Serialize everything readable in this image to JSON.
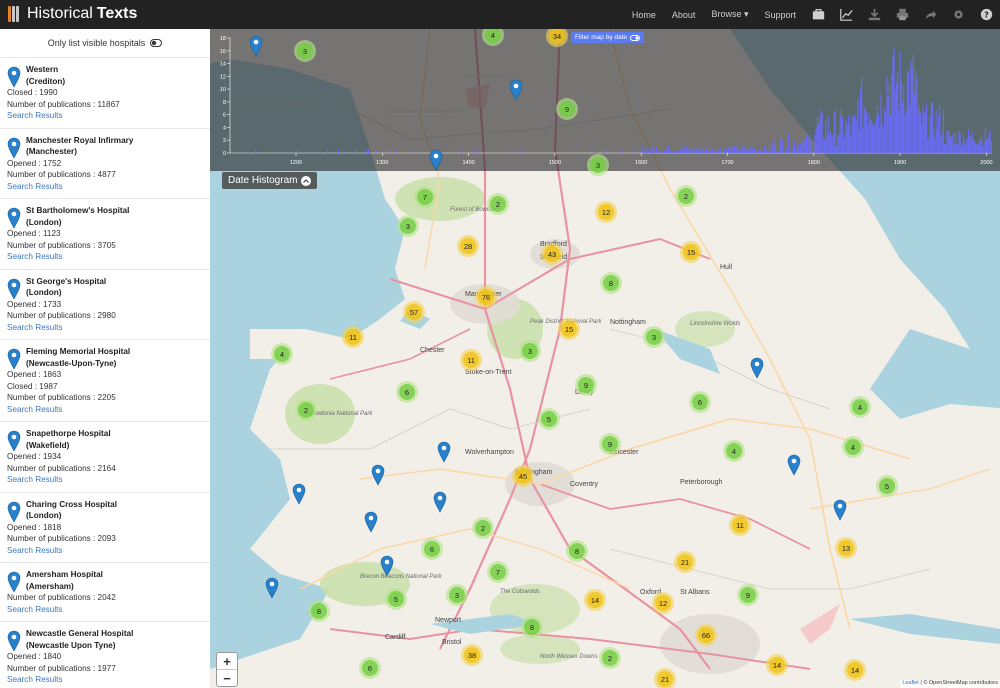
{
  "app": {
    "brand_part1": "Historical",
    "brand_part2": "Texts"
  },
  "nav": {
    "home": "Home",
    "about": "About",
    "browse": "Browse ▾",
    "support": "Support",
    "icons": [
      "briefcase-icon",
      "chart-icon",
      "download-icon",
      "print-icon",
      "share-icon",
      "settings-icon",
      "help-icon"
    ]
  },
  "sidebar": {
    "toggle_label": "Only list visible hospitals",
    "hospitals": [
      {
        "name": "Western",
        "place": "(Crediton)",
        "lines": [
          "Closed : 1990",
          "Number of publications : 11867"
        ],
        "link": "Search Results"
      },
      {
        "name": "Manchester Royal Infirmary",
        "place": "(Manchester)",
        "lines": [
          "Opened : 1752",
          "Number of publications : 4877"
        ],
        "link": "Search Results"
      },
      {
        "name": "St Bartholomew's Hospital",
        "place": "(London)",
        "lines": [
          "Opened : 1123",
          "Number of publications : 3705"
        ],
        "link": "Search Results"
      },
      {
        "name": "St George's Hospital",
        "place": "(London)",
        "lines": [
          "Opened : 1733",
          "Number of publications : 2980"
        ],
        "link": "Search Results"
      },
      {
        "name": "Fleming Memorial Hospital",
        "place": "(Newcastle-Upon-Tyne)",
        "lines": [
          "Opened : 1863",
          "Closed : 1987",
          "Number of publications : 2205"
        ],
        "link": "Search Results"
      },
      {
        "name": "Snapethorpe Hospital",
        "place": "(Wakefield)",
        "lines": [
          "Opened : 1934",
          "Number of publications : 2164"
        ],
        "link": "Search Results"
      },
      {
        "name": "Charing Cross Hospital",
        "place": "(London)",
        "lines": [
          "Opened : 1818",
          "Number of publications : 2093"
        ],
        "link": "Search Results"
      },
      {
        "name": "Amersham Hospital",
        "place": "(Amersham)",
        "lines": [
          "Number of publications : 2042"
        ],
        "link": "Search Results"
      },
      {
        "name": "Newcastle General Hospital",
        "place": "(Newcastle Upon Tyne)",
        "lines": [
          "Opened : 1840",
          "Number of publications : 1977"
        ],
        "link": "Search Results"
      }
    ]
  },
  "histogram": {
    "button_label": "Date Histogram",
    "filter_label": "Filter map by date",
    "y_ticks": [
      "18",
      "16",
      "14",
      "12",
      "10",
      "8",
      "6",
      "4",
      "2",
      "0"
    ],
    "x_ticks": [
      "1200",
      "1300",
      "1400",
      "1500",
      "1600",
      "1700",
      "1800",
      "1900",
      "2000"
    ]
  },
  "map": {
    "clusters": [
      {
        "label": "3",
        "c": "g"
      },
      {
        "label": "4",
        "c": "g"
      },
      {
        "label": "34",
        "c": "y"
      },
      {
        "label": "9",
        "c": "g"
      },
      {
        "label": "3",
        "c": "g"
      },
      {
        "label": "7",
        "c": "g"
      },
      {
        "label": "2",
        "c": "g"
      },
      {
        "label": "12",
        "c": "y"
      },
      {
        "label": "2",
        "c": "g"
      },
      {
        "label": "3",
        "c": "g"
      },
      {
        "label": "28",
        "c": "y"
      },
      {
        "label": "43",
        "c": "y"
      },
      {
        "label": "15",
        "c": "y"
      },
      {
        "label": "8",
        "c": "g"
      },
      {
        "label": "76",
        "c": "y"
      },
      {
        "label": "57",
        "c": "y"
      },
      {
        "label": "15",
        "c": "y"
      },
      {
        "label": "11",
        "c": "y"
      },
      {
        "label": "3",
        "c": "g"
      },
      {
        "label": "3",
        "c": "g"
      },
      {
        "label": "4",
        "c": "g"
      },
      {
        "label": "11",
        "c": "y"
      },
      {
        "label": "6",
        "c": "g"
      },
      {
        "label": "9",
        "c": "g"
      },
      {
        "label": "2",
        "c": "g"
      },
      {
        "label": "5",
        "c": "g"
      },
      {
        "label": "6",
        "c": "g"
      },
      {
        "label": "4",
        "c": "g"
      },
      {
        "label": "9",
        "c": "g"
      },
      {
        "label": "4",
        "c": "g"
      },
      {
        "label": "4",
        "c": "g"
      },
      {
        "label": "45",
        "c": "y"
      },
      {
        "label": "5",
        "c": "g"
      },
      {
        "label": "11",
        "c": "y"
      },
      {
        "label": "2",
        "c": "g"
      },
      {
        "label": "6",
        "c": "g"
      },
      {
        "label": "8",
        "c": "g"
      },
      {
        "label": "13",
        "c": "y"
      },
      {
        "label": "21",
        "c": "y"
      },
      {
        "label": "7",
        "c": "g"
      },
      {
        "label": "3",
        "c": "g"
      },
      {
        "label": "5",
        "c": "g"
      },
      {
        "label": "14",
        "c": "y"
      },
      {
        "label": "12",
        "c": "y"
      },
      {
        "label": "9",
        "c": "g"
      },
      {
        "label": "8",
        "c": "g"
      },
      {
        "label": "8",
        "c": "g"
      },
      {
        "label": "66",
        "c": "y"
      },
      {
        "label": "38",
        "c": "y"
      },
      {
        "label": "2",
        "c": "g"
      },
      {
        "label": "6",
        "c": "g"
      },
      {
        "label": "21",
        "c": "y"
      },
      {
        "label": "14",
        "c": "y"
      },
      {
        "label": "14",
        "c": "y"
      }
    ],
    "zoom_in": "+",
    "zoom_out": "−",
    "attribution_leaflet": "Leaflet",
    "attribution_rest": " | © OpenStreetMap contributors",
    "places": [
      "North Pennines",
      "Lake District National Park",
      "Forest of Bowland",
      "Peak District National Park",
      "Snowdonia National Park",
      "Brecon Beacons National Park",
      "The Cotswolds",
      "Lincolnshire Wolds",
      "North Wessex Downs"
    ],
    "cities": [
      "Manchester",
      "Sheffield",
      "Birmingham",
      "Leicester",
      "Derby",
      "Stoke-on-Trent",
      "Wolverhampton",
      "Coventry",
      "Peterborough",
      "Cardiff",
      "Bristol",
      "Newport",
      "Oxford",
      "St Albans",
      "Chester",
      "Bradford",
      "Hull",
      "Nottingham"
    ]
  },
  "colors": {
    "navbar": "#222222",
    "link": "#3a78c2",
    "histogram_bars": "#6a6cf5",
    "pin": "#2a81cb"
  }
}
